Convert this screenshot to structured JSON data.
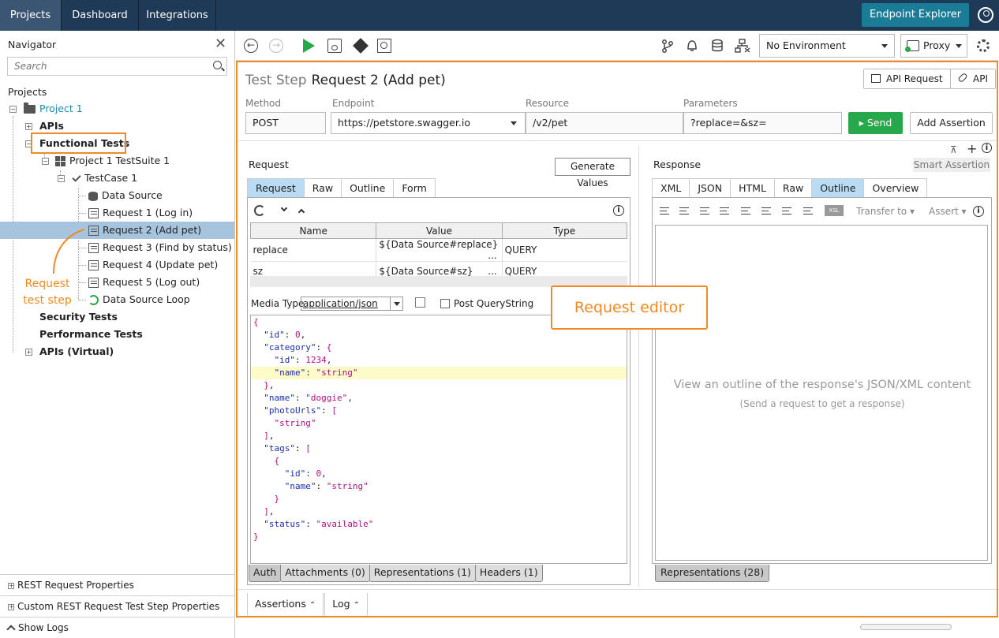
{
  "topnav": {
    "tabs": [
      {
        "label": "Projects"
      },
      {
        "label": "Dashboard"
      },
      {
        "label": "Integrations"
      }
    ],
    "endpoint_explorer": "Endpoint Explorer",
    "user_icon": "user-circle-icon"
  },
  "navigator": {
    "title": "Navigator",
    "search_placeholder": "Search",
    "section": "Projects",
    "tree": {
      "project": "Project 1",
      "apis": "APIs",
      "functional_tests": "Functional Tests",
      "testsuite": "Project 1 TestSuite 1",
      "testcase": "TestCase 1",
      "steps": [
        "Data Source",
        "Request 1 (Log in)",
        "Request 2 (Add pet)",
        "Request 3 (Find by status)",
        "Request 4 (Update pet)",
        "Request 5 (Log out)",
        "Data Source Loop"
      ],
      "security_tests": "Security Tests",
      "performance_tests": "Performance Tests",
      "apis_virtual": "APIs (Virtual)"
    },
    "annotation": "Request test step",
    "bottom": {
      "rest_props": "REST Request Properties",
      "custom_props": "Custom REST Request Test Step Properties",
      "show_logs": "Show Logs"
    }
  },
  "toolbar": {
    "environment": "No Environment",
    "proxy": "Proxy"
  },
  "step": {
    "label": "Test Step",
    "name": "Request 2 (Add pet)",
    "api_request_btn": "API Request",
    "api_btn": "API",
    "fields": {
      "method_label": "Method",
      "method": "POST",
      "endpoint_label": "Endpoint",
      "endpoint": "https://petstore.swagger.io",
      "resource_label": "Resource",
      "resource": "/v2/pet",
      "parameters_label": "Parameters",
      "parameters": "?replace=&sz="
    },
    "send": "Send",
    "add_assertion": "Add Assertion"
  },
  "request": {
    "title": "Request",
    "generate_values": "Generate Values",
    "tabs": [
      "Request",
      "Raw",
      "Outline",
      "Form"
    ],
    "table": {
      "headers": [
        "Name",
        "Value",
        "Type"
      ],
      "rows": [
        {
          "name": "replace",
          "value": "${Data Source#replace}",
          "more": "...",
          "type": "QUERY"
        },
        {
          "name": "sz",
          "value": "${Data Source#sz}",
          "more": "...",
          "type": "QUERY"
        }
      ]
    },
    "media_type_label": "Media Type",
    "media_type": "application/json",
    "post_querystring": "Post QueryString",
    "body_lines": [
      "{",
      "  \"id\": 0,",
      "  \"category\": {",
      "    \"id\": 1234,",
      "    \"name\": \"string\"",
      "  },",
      "  \"name\": \"doggie\",",
      "  \"photoUrls\": [",
      "    \"string\"",
      "  ],",
      "  \"tags\": [",
      "    {",
      "      \"id\": 0,",
      "      \"name\": \"string\"",
      "    }",
      "  ],",
      "  \"status\": \"available\"",
      "}"
    ],
    "bottom_tabs": [
      "Auth",
      "Attachments (0)",
      "Representations (1)",
      "Headers (1)"
    ]
  },
  "response": {
    "title": "Response",
    "smart_assertion": "Smart Assertion",
    "tabs": [
      "XML",
      "JSON",
      "HTML",
      "Raw",
      "Outline",
      "Overview"
    ],
    "xsl": "XSL",
    "transfer_to": "Transfer to",
    "assert": "Assert",
    "empty_title": "View an outline of the response's JSON/XML content",
    "empty_sub": "(Send a request to get a response)",
    "bottom_tab": "Representations (28)"
  },
  "bottom_tabs": {
    "assertions": "Assertions",
    "log": "Log"
  },
  "callout": "Request editor",
  "colors": {
    "accent_orange": "#f08a24",
    "send_green": "#27a84a",
    "nav_dark": "#1e3a56",
    "tab_active": "#b9dbf3"
  }
}
